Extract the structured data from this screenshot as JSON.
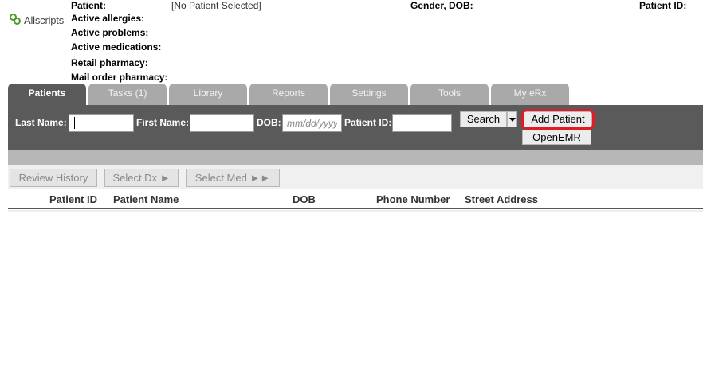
{
  "brand": {
    "name": "Allscripts"
  },
  "header": {
    "patient_label": "Patient:",
    "patient_value": "[No Patient Selected]",
    "gender_dob_label": "Gender, DOB:",
    "patient_id_label": "Patient ID:",
    "active_allergies_label": "Active allergies:",
    "active_problems_label": "Active problems:",
    "active_medications_label": "Active medications:",
    "retail_pharmacy_label": "Retail pharmacy:",
    "mail_order_pharmacy_label": "Mail order pharmacy:"
  },
  "tabs": [
    {
      "label": "Patients",
      "active": true
    },
    {
      "label": "Tasks (1)",
      "active": false
    },
    {
      "label": "Library",
      "active": false
    },
    {
      "label": "Reports",
      "active": false
    },
    {
      "label": "Settings",
      "active": false
    },
    {
      "label": "Tools",
      "active": false
    },
    {
      "label": "My eRx",
      "active": false
    }
  ],
  "search": {
    "last_name_label": "Last Name:",
    "last_name_value": "",
    "first_name_label": "First Name:",
    "first_name_value": "",
    "dob_label": "DOB:",
    "dob_placeholder": "mm/dd/yyyy",
    "patient_id_label": "Patient ID:",
    "patient_id_value": "",
    "search_button": "Search",
    "add_patient_button": "Add Patient",
    "openemr_button": "OpenEMR"
  },
  "toolbar": {
    "review_history": "Review History",
    "select_dx": "Select Dx ►",
    "select_med": "Select Med ►►"
  },
  "table": {
    "columns": [
      "Patient ID",
      "Patient Name",
      "DOB",
      "Phone Number",
      "Street Address"
    ],
    "rows": []
  },
  "colors": {
    "tab_active": "#5a5a5a",
    "tab_inactive": "#a9a9a9",
    "search_band": "#5a5a5a",
    "highlight": "#e01b24",
    "brand_green": "#4c9a2a"
  }
}
